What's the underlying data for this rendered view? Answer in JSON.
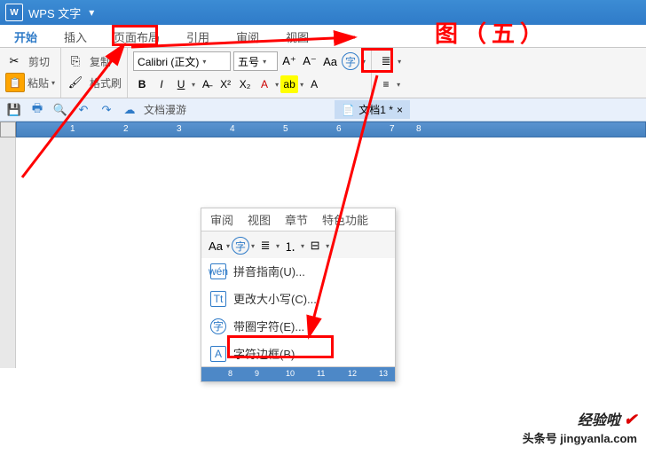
{
  "title": {
    "app": "WPS 文字"
  },
  "tabs": {
    "start": "开始",
    "insert": "插入",
    "layout": "页面布局",
    "reference": "引用",
    "review": "审阅",
    "view": "视图"
  },
  "clipboard": {
    "cut": "剪切",
    "copy": "复制",
    "paste": "粘贴",
    "fmtpainter": "格式刷"
  },
  "font": {
    "name": "Calibri (正文)",
    "size": "五号"
  },
  "qat": {
    "docnav": "文档漫游",
    "doctab": "文档1 *"
  },
  "popup": {
    "tabs": {
      "review": "审阅",
      "view": "视图",
      "chapter": "章节",
      "special": "特色功能"
    },
    "menu": {
      "pinyin": "拼音指南(U)...",
      "changecase": "更改大小写(C)...",
      "enclosed": "带圈字符(E)...",
      "border": "字符边框(B)"
    }
  },
  "ruler": {
    "n1": "1",
    "n2": "2",
    "n3": "3",
    "n4": "4",
    "n5": "5",
    "n6": "6",
    "n7": "7",
    "n8": "8"
  },
  "pruler": {
    "n8": "8",
    "n9": "9",
    "n10": "10",
    "n11": "11",
    "n12": "12",
    "n13": "13"
  },
  "annotation": {
    "caption": "图（五）"
  },
  "watermark": {
    "line1": "经验啦",
    "line2": "头条号 jingyanla.com"
  }
}
